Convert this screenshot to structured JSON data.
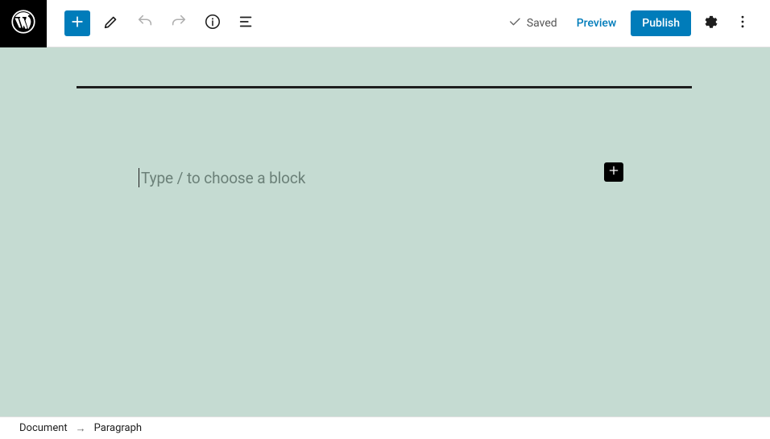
{
  "toolbar": {
    "saved_label": "Saved",
    "preview_label": "Preview",
    "publish_label": "Publish"
  },
  "editor": {
    "placeholder": "Type / to choose a block"
  },
  "breadcrumb": {
    "root": "Document",
    "current": "Paragraph",
    "separator": "→"
  },
  "colors": {
    "primary": "#007cba",
    "canvas_bg": "#c5dbd2"
  }
}
